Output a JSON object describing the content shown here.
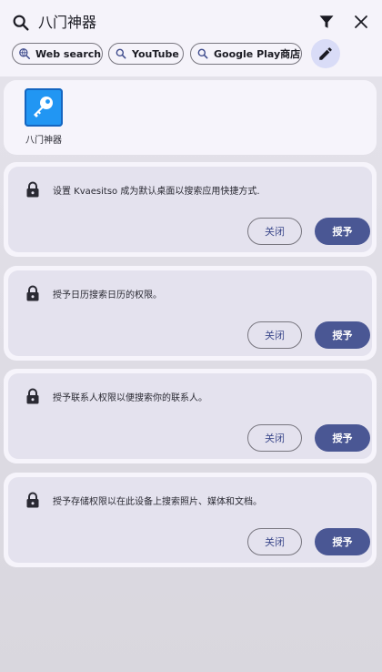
{
  "search": {
    "query": "八门神器",
    "icons": {
      "search": "search-icon",
      "filter": "filter-icon",
      "close": "close-icon"
    }
  },
  "chips": [
    {
      "label": "Web search",
      "icon": "web-search-icon"
    },
    {
      "label": "YouTube",
      "icon": "search-icon"
    },
    {
      "label": "Google Play商店",
      "icon": "search-icon"
    }
  ],
  "edit_icon": "pencil-icon",
  "app": {
    "name": "八门神器",
    "icon": "key-wrench-icon"
  },
  "permissions": [
    {
      "text": "设置 Kvaesitso 成为默认桌面以搜索应用快捷方式.",
      "dismiss": "关闭",
      "grant": "授予"
    },
    {
      "text": "授予日历搜索日历的权限。",
      "dismiss": "关闭",
      "grant": "授予"
    },
    {
      "text": "授予联系人权限以便搜索你的联系人。",
      "dismiss": "关闭",
      "grant": "授予"
    },
    {
      "text": "授予存储权限以在此设备上搜索照片、媒体和文档。",
      "dismiss": "关闭",
      "grant": "授予"
    }
  ],
  "colors": {
    "accent": "#4a5794",
    "accent_text": "#3d4a8c",
    "chip_selected": "#d9dcf7",
    "app_icon": "#2196f3"
  }
}
